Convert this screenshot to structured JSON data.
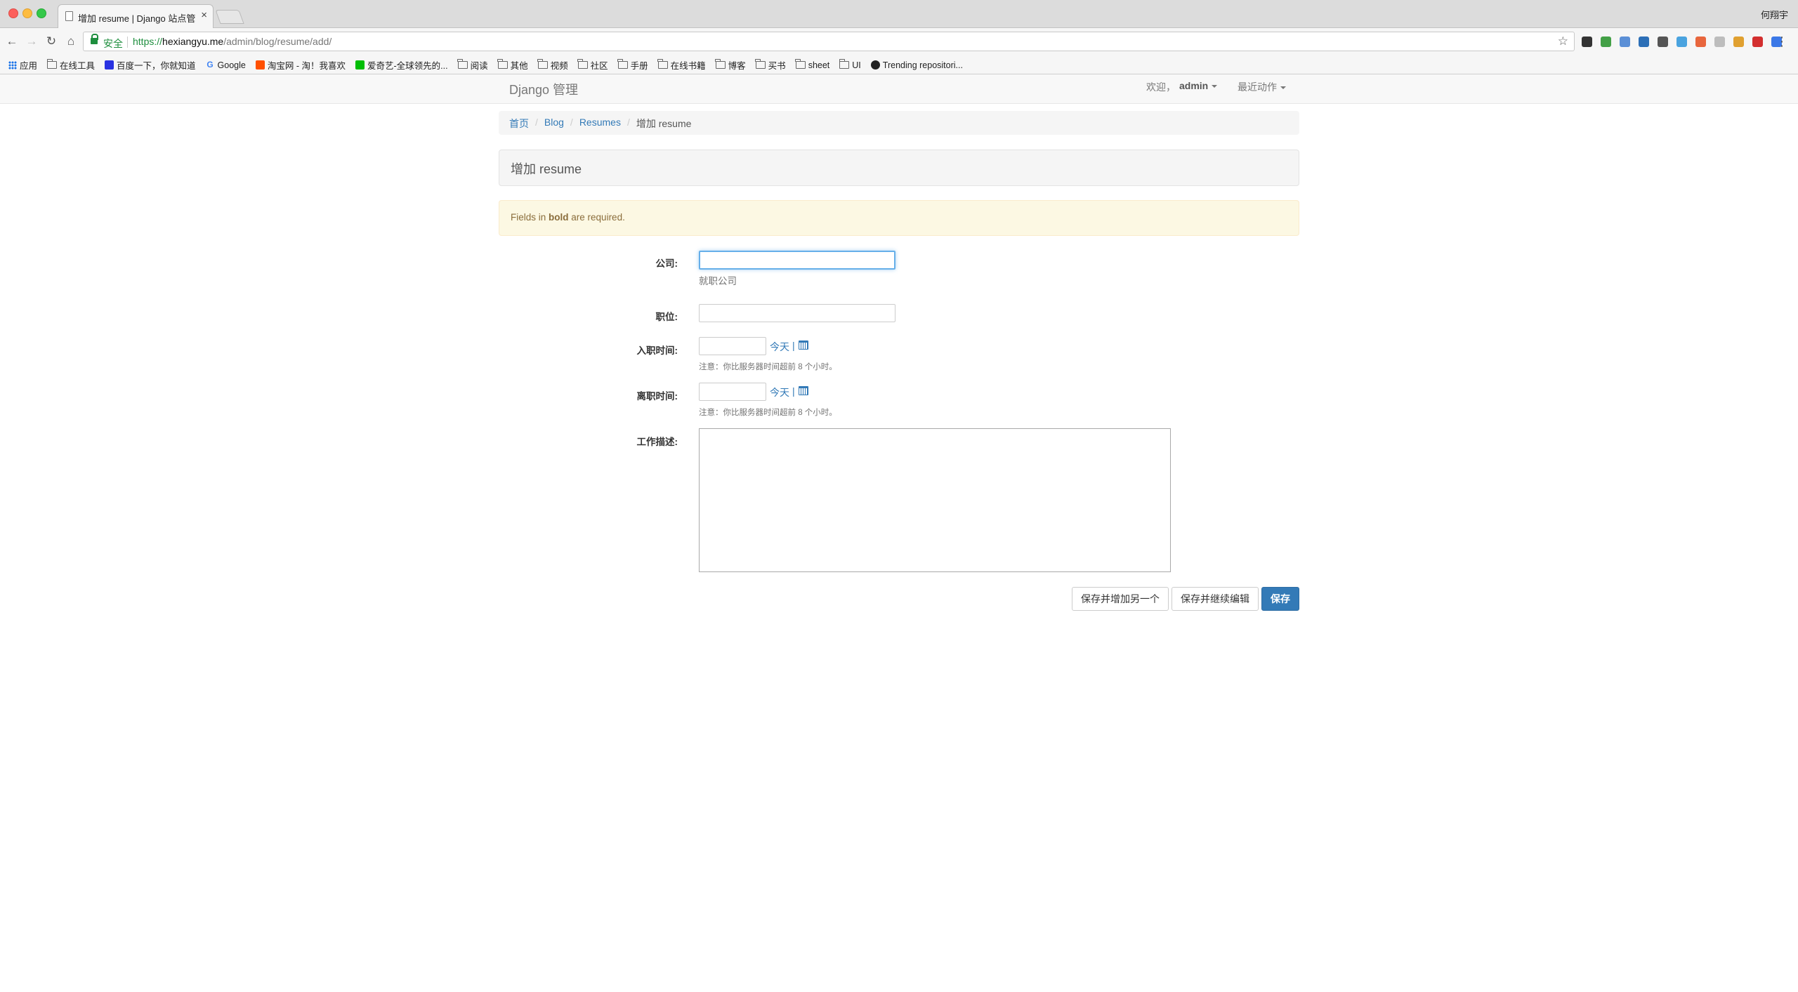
{
  "browser": {
    "tab_title": "增加 resume | Django 站点管理",
    "tab_close": "×",
    "profile_name": "何翔宇",
    "secure_label": "安全",
    "url_scheme": "https://",
    "url_host": "hexiangyu.me",
    "url_path": "/admin/blog/resume/add/",
    "bookmarks": [
      {
        "label": "应用",
        "icon": "apps-icon"
      },
      {
        "label": "在线工具",
        "icon": "folder-icon"
      },
      {
        "label": "百度一下，你就知道",
        "icon": "baidu-icon"
      },
      {
        "label": "Google",
        "icon": "google-icon"
      },
      {
        "label": "淘宝网 - 淘！我喜欢",
        "icon": "taobao-icon"
      },
      {
        "label": "爱奇艺-全球领先的...",
        "icon": "iqiyi-icon"
      },
      {
        "label": "阅读",
        "icon": "folder-icon"
      },
      {
        "label": "其他",
        "icon": "folder-icon"
      },
      {
        "label": "视频",
        "icon": "folder-icon"
      },
      {
        "label": "社区",
        "icon": "folder-icon"
      },
      {
        "label": "手册",
        "icon": "folder-icon"
      },
      {
        "label": "在线书籍",
        "icon": "folder-icon"
      },
      {
        "label": "博客",
        "icon": "folder-icon"
      },
      {
        "label": "买书",
        "icon": "folder-icon"
      },
      {
        "label": "sheet",
        "icon": "folder-icon"
      },
      {
        "label": "UI",
        "icon": "folder-icon"
      },
      {
        "label": "Trending repositori...",
        "icon": "github-icon"
      }
    ],
    "extension_colors": [
      "#333333",
      "#43a047",
      "#5b8fd6",
      "#2c6fb7",
      "#555555",
      "#4aa3df",
      "#e8663d",
      "#bdbdbd",
      "#e0a030",
      "#d32f2f",
      "#3b78e7"
    ]
  },
  "navbar": {
    "brand": "Django 管理",
    "welcome": "欢迎，",
    "user": "admin",
    "recent_actions": "最近动作"
  },
  "breadcrumb": {
    "home": "首页",
    "app": "Blog",
    "model": "Resumes",
    "current": "增加 resume",
    "separator": "/"
  },
  "page": {
    "title": "增加 resume",
    "alert_prefix": "Fields in ",
    "alert_bold": "bold",
    "alert_suffix": " are required."
  },
  "form": {
    "company_label": "公司:",
    "company_value": "",
    "company_help": "就职公司",
    "position_label": "职位:",
    "position_value": "",
    "start_label": "入职时间:",
    "start_value": "",
    "end_label": "离职时间:",
    "end_value": "",
    "today_link": "今天",
    "pipe": "|",
    "timezone_note": "注意：你比服务器时间超前 8 个小时。",
    "description_label": "工作描述:",
    "description_value": ""
  },
  "buttons": {
    "save_add_another": "保存并增加另一个",
    "save_continue": "保存并继续编辑",
    "save": "保存"
  }
}
